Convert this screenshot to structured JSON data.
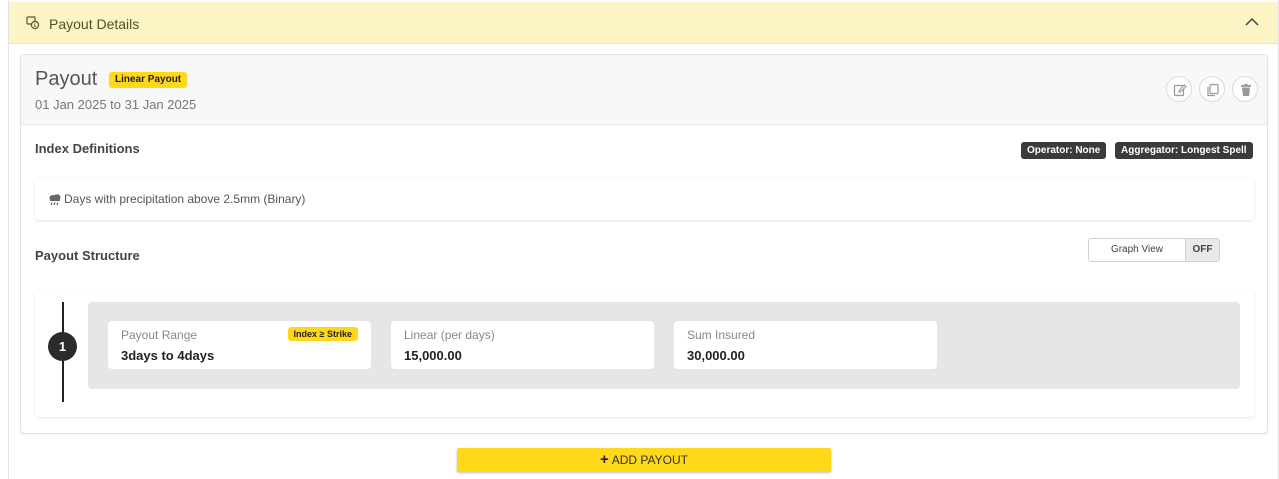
{
  "header": {
    "title": "Payout Details",
    "icon": "payout-icon",
    "toggle_icon": "chevron-up-icon"
  },
  "payout": {
    "title": "Payout",
    "type_badge": "Linear Payout",
    "dates": "01 Jan 2025 to 31 Jan 2025",
    "actions": {
      "edit_icon": "edit-icon",
      "copy_icon": "copy-icon",
      "delete_icon": "trash-icon"
    }
  },
  "index_definitions": {
    "title": "Index Definitions",
    "operator_badge": "Operator: None",
    "aggregator_badge": "Aggregator: Longest Spell",
    "item_icon": "rain-cloud-icon",
    "item_text": "Days with precipitation above 2.5mm (Binary)"
  },
  "payout_structure": {
    "title": "Payout Structure",
    "graph_view_label": "Graph View",
    "graph_view_state": "OFF",
    "steps": [
      {
        "number": "1",
        "range_label": "Payout Range",
        "range_badge": "Index ≥ Strike",
        "range_value": "3days to 4days",
        "linear_label": "Linear (per days)",
        "linear_value": "15,000.00",
        "sum_label": "Sum Insured",
        "sum_value": "30,000.00"
      }
    ]
  },
  "add_button": {
    "label": "ADD PAYOUT",
    "icon": "plus-icon"
  },
  "colors": {
    "accent_yellow": "#ffd81a",
    "header_bg": "#fdf4c6",
    "dark_badge": "#3b3b3b"
  }
}
